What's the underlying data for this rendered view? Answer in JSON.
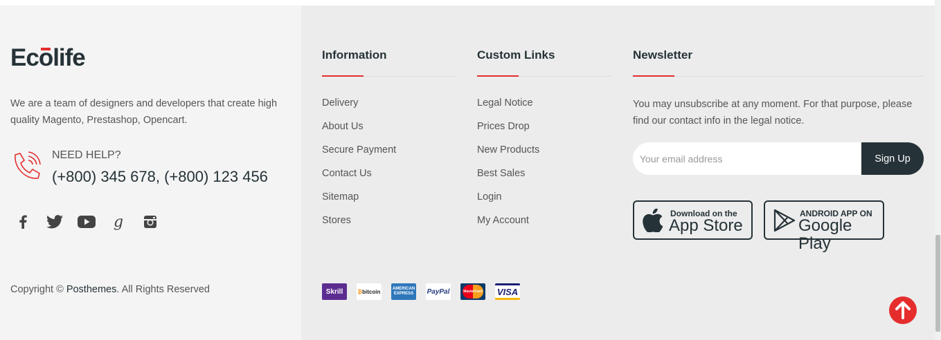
{
  "brand": {
    "logo_prefix": "Ec",
    "logo_macron": "o",
    "logo_suffix": "life",
    "about": "We are a team of designers and developers that create high quality Magento, Prestashop, Opencart.",
    "help_label": "NEED HELP?",
    "help_phone": "(+800) 345 678, (+800) 123 456",
    "social": [
      "facebook-icon",
      "twitter-icon",
      "youtube-icon",
      "google-plus-icon",
      "instagram-icon"
    ],
    "copyright_prefix": "Copyright © ",
    "copyright_brand": "Posthemes",
    "copyright_suffix": ". All Rights Reserved"
  },
  "information": {
    "title": "Information",
    "links": [
      "Delivery",
      "About Us",
      "Secure Payment",
      "Contact Us",
      "Sitemap",
      "Stores"
    ]
  },
  "custom_links": {
    "title": "Custom Links",
    "links": [
      "Legal Notice",
      "Prices Drop",
      "New Products",
      "Best Sales",
      "Login",
      "My Account"
    ]
  },
  "newsletter": {
    "title": "Newsletter",
    "text": "You may unsubscribe at any moment. For that purpose, please find our contact info in the legal notice.",
    "placeholder": "Your email address",
    "button": "Sign Up"
  },
  "apps": {
    "apple_small": "Download on the",
    "apple_big": "App Store",
    "google_small": "ANDROID APP ON",
    "google_big": "Google Play"
  },
  "payments": [
    "Skrill",
    "bitcoin",
    "AMERICAN EXPRESS",
    "PayPal",
    "MasterCard",
    "VISA"
  ],
  "colors": {
    "accent": "#e52d2d",
    "dark": "#253237",
    "left_bg": "#f4f4f4",
    "right_bg": "#ececec"
  }
}
